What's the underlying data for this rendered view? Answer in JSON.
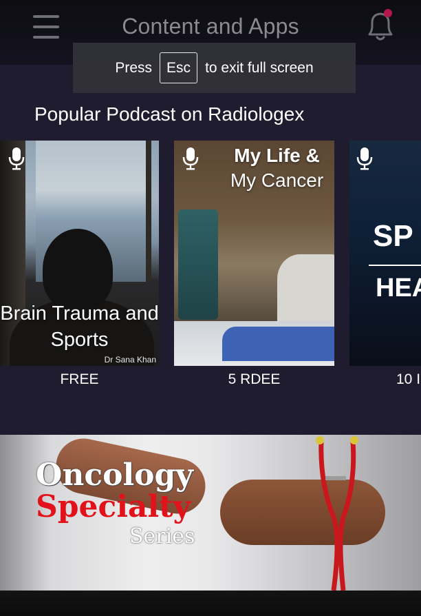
{
  "header": {
    "title": "Content and Apps",
    "menu_icon": "hamburger-menu-icon",
    "notification_icon": "bell-icon",
    "notification_dot_color": "#b2164a"
  },
  "fullscreen_toast": {
    "prefix": "Press",
    "key": "Esc",
    "suffix": "to exit full screen"
  },
  "popular_section": {
    "title": "Popular Podcast on Radiologex",
    "cards": [
      {
        "title": "Brain Trauma and Sports",
        "author": "Dr Sana Khan",
        "price": "FREE",
        "icon": "microphone-icon"
      },
      {
        "title_line1": "My Life &",
        "title_line2": "My Cancer",
        "price": "5 RDEE",
        "icon": "microphone-icon"
      },
      {
        "title_line1": "SP",
        "title_line2": "HEA",
        "price": "10 I",
        "icon": "microphone-icon"
      }
    ]
  },
  "banner": {
    "line1": "Oncology",
    "line2": "Specialty",
    "line3": "Series",
    "accent_color": "#e2121b"
  }
}
